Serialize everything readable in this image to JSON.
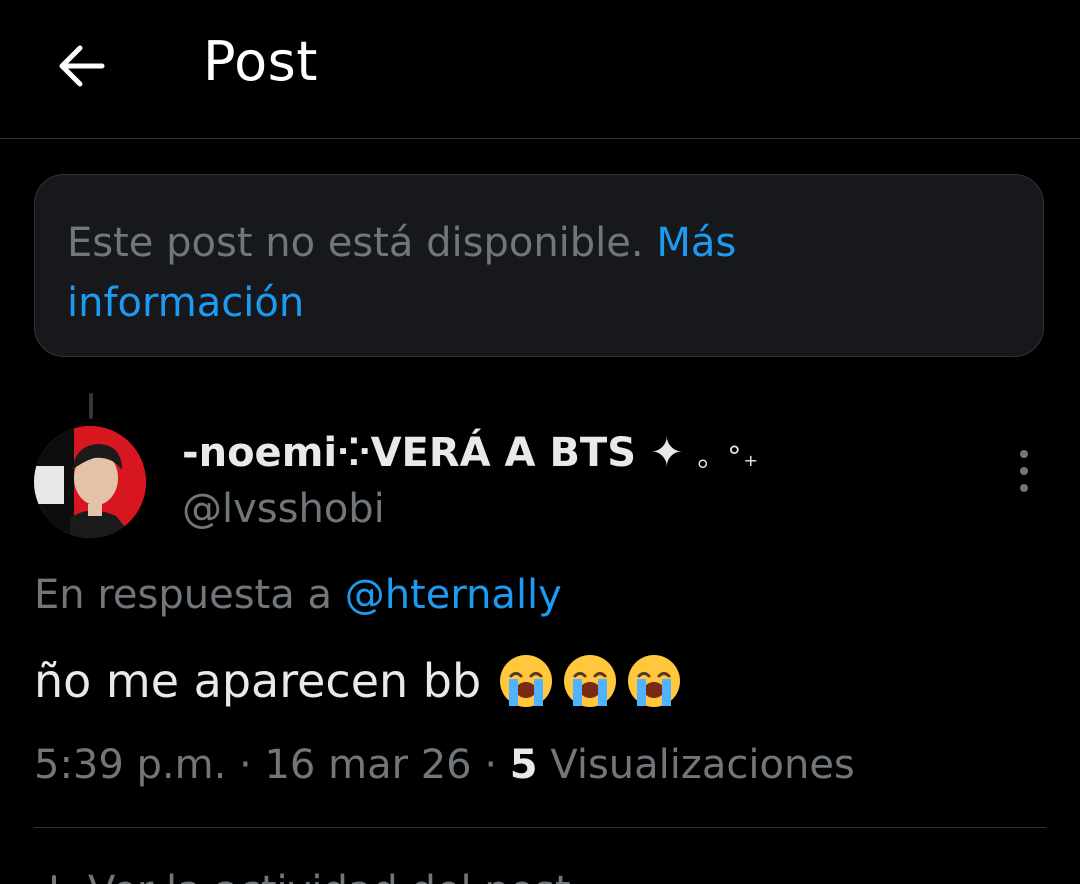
{
  "header": {
    "title": "Post",
    "back_icon": "arrow-left-icon"
  },
  "notice": {
    "text": "Este post no está disponible.",
    "link": "Más información"
  },
  "post": {
    "display_name": "-noemi⁘VERÁ A BTS",
    "name_sparkle": "✦",
    "name_tail": "。°₊",
    "handle": "@lvsshobi",
    "reply_prefix": "En respuesta a",
    "reply_to": "@hternally",
    "text": "ño me aparecen bb",
    "emojis": [
      "loudly-crying-face",
      "loudly-crying-face",
      "loudly-crying-face"
    ],
    "time": "5:39 p.m.",
    "sep1": "·",
    "date": "16 mar 26",
    "sep2": "·",
    "views_count": "5",
    "views_label": "Visualizaciones"
  },
  "activity": {
    "label": "Ver la actividad del post"
  },
  "colors": {
    "background": "#000000",
    "card": "#16181c",
    "border": "#2f3336",
    "secondary_text": "#71767b",
    "primary_text": "#e7e9ea",
    "link": "#1d9bf0"
  }
}
